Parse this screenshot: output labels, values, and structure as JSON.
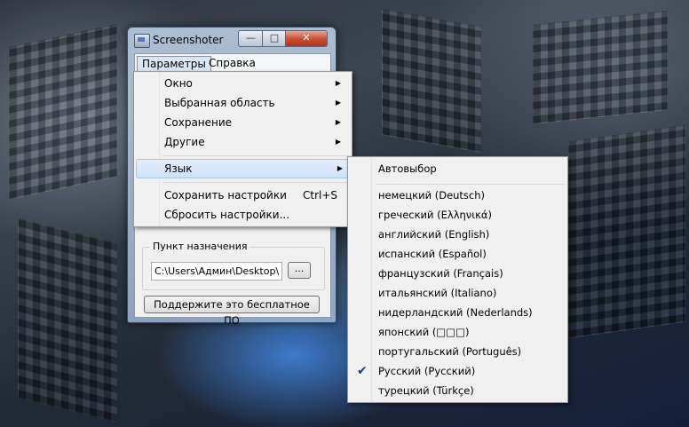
{
  "window": {
    "title": "Screenshoter",
    "minimize": "—",
    "maximize": "□",
    "close": "✕"
  },
  "menubar": [
    "Параметры",
    "Справка"
  ],
  "main_menu": {
    "items": [
      {
        "label": "Окно",
        "submenu": true
      },
      {
        "label": "Выбранная область",
        "submenu": true
      },
      {
        "label": "Сохранение",
        "submenu": true
      },
      {
        "label": "Другие",
        "submenu": true
      },
      {
        "label": "Язык",
        "submenu": true,
        "highlighted": true
      },
      {
        "label": "Сохранить настройки",
        "shortcut": "Ctrl+S"
      },
      {
        "label": "Сбросить настройки..."
      }
    ],
    "arrow": "▶"
  },
  "language_menu": {
    "items": [
      {
        "label": "Автовыбор"
      },
      {
        "label": "немецкий  (Deutsch)"
      },
      {
        "label": "греческий  (Ελληνικά)"
      },
      {
        "label": "английский  (English)"
      },
      {
        "label": "испанский  (Español)"
      },
      {
        "label": "французский  (Français)"
      },
      {
        "label": "итальянский  (Italiano)"
      },
      {
        "label": "нидерландский  (Nederlands)"
      },
      {
        "label": "японский  (□□□)"
      },
      {
        "label": "португальский  (Português)"
      },
      {
        "label": "Русский  (Русский)",
        "checked": true
      },
      {
        "label": "турецкий  (Türkçe)"
      }
    ],
    "check": "✔"
  },
  "destination": {
    "label": "Пункт назначения",
    "path": "C:\\Users\\Админ\\Desktop\\",
    "browse": "..."
  },
  "support_button": "Поддержите это бесплатное ПО"
}
